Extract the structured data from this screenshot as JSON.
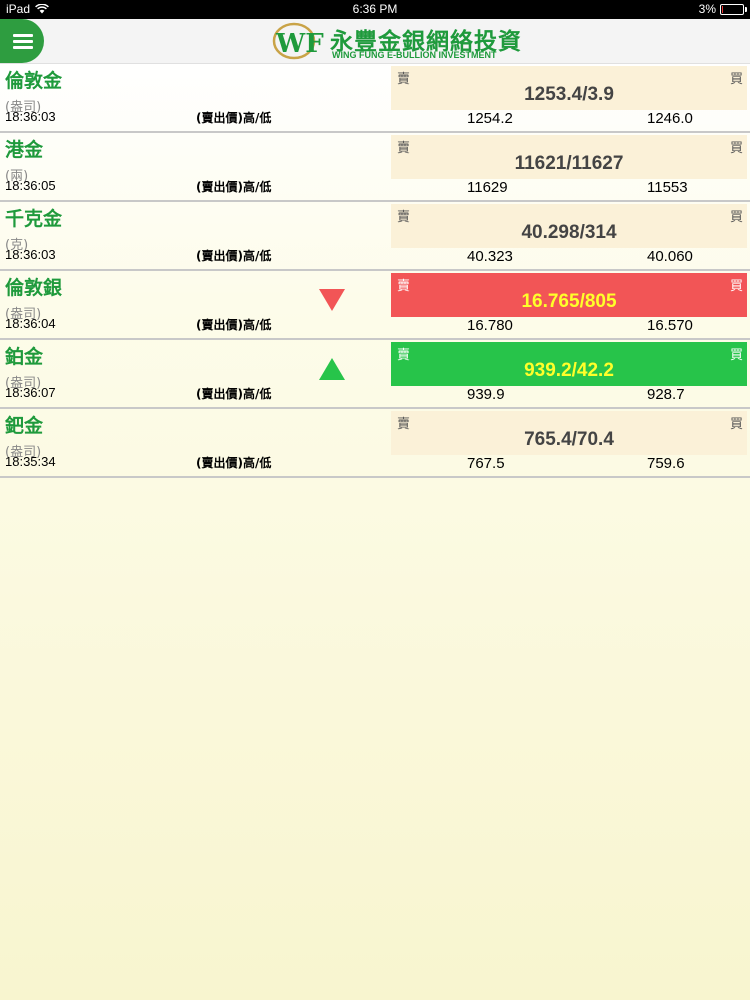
{
  "status_bar": {
    "device": "iPad",
    "time": "6:36 PM",
    "battery": "3%",
    "battery_level": 0.03
  },
  "header": {
    "logo_cn": "永豐金銀網絡投資",
    "logo_en": "WING FUNG E-BULLION INVESTMENT",
    "logo_mark": "WF"
  },
  "colors": {
    "brand_green": "#1f9a3c",
    "down_red": "#f25556",
    "up_green": "#27c44a",
    "price_highlight": "#ffff2a"
  },
  "quotes": [
    {
      "name": "倫敦金",
      "unit": "(盎司)",
      "time": "18:36:03",
      "hl_label": "(賣出價)高/低",
      "sell_label": "賣",
      "buy_label": "買",
      "price": "1253.4/3.9",
      "high": "1254.2",
      "low": "1246.0",
      "trend": "none"
    },
    {
      "name": "港金",
      "unit": "(兩)",
      "time": "18:36:05",
      "hl_label": "(賣出價)高/低",
      "sell_label": "賣",
      "buy_label": "買",
      "price": "11621/11627",
      "high": "11629",
      "low": "11553",
      "trend": "none"
    },
    {
      "name": "千克金",
      "unit": "(克)",
      "time": "18:36:03",
      "hl_label": "(賣出價)高/低",
      "sell_label": "賣",
      "buy_label": "買",
      "price": "40.298/314",
      "high": "40.323",
      "low": "40.060",
      "trend": "none"
    },
    {
      "name": "倫敦銀",
      "unit": "(盎司)",
      "time": "18:36:04",
      "hl_label": "(賣出價)高/低",
      "sell_label": "賣",
      "buy_label": "買",
      "price": "16.765/805",
      "high": "16.780",
      "low": "16.570",
      "trend": "down"
    },
    {
      "name": "鉑金",
      "unit": "(盎司)",
      "time": "18:36:07",
      "hl_label": "(賣出價)高/低",
      "sell_label": "賣",
      "buy_label": "買",
      "price": "939.2/42.2",
      "high": "939.9",
      "low": "928.7",
      "trend": "up"
    },
    {
      "name": "鈀金",
      "unit": "(盎司)",
      "time": "18:35:34",
      "hl_label": "(賣出價)高/低",
      "sell_label": "賣",
      "buy_label": "買",
      "price": "765.4/70.4",
      "high": "767.5",
      "low": "759.6",
      "trend": "none"
    }
  ]
}
